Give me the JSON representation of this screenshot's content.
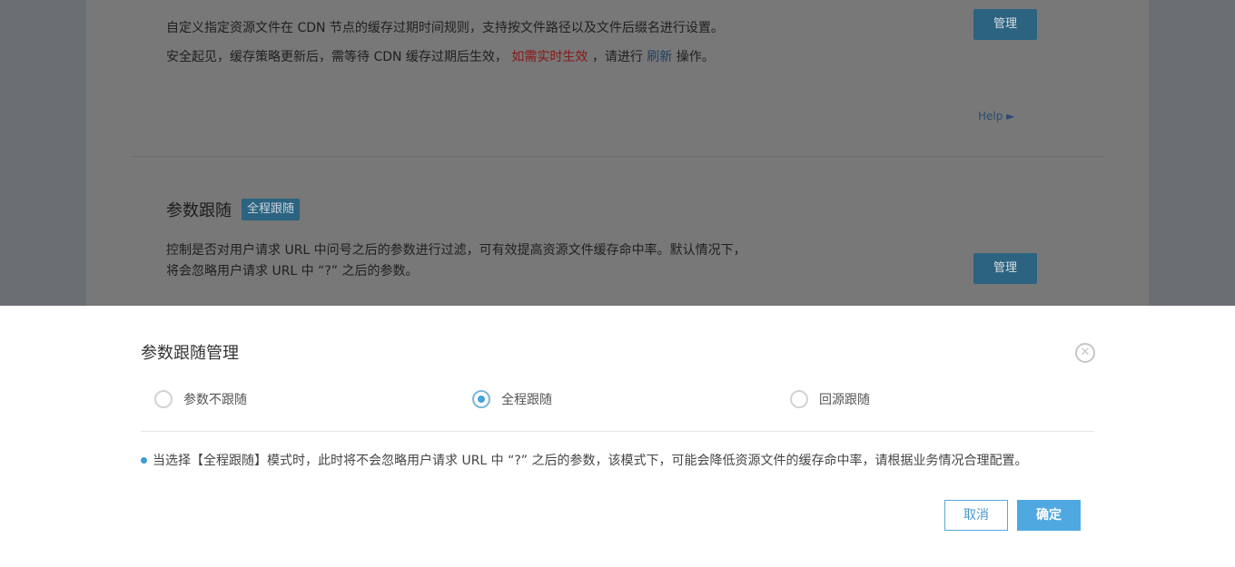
{
  "background": {
    "cache_desc_line1": "自定义指定资源文件在 CDN 节点的缓存过期时间规则，支持按文件路径以及文件后缀名进行设置。",
    "cache_desc_line2_pre": "安全起见，缓存策略更新后，需等待 CDN 缓存过期后生效，",
    "cache_desc_line2_red": "如需实时生效",
    "cache_desc_line2_mid": "，请进行",
    "cache_desc_line2_link": "刷新",
    "cache_desc_line2_post": "操作。",
    "manage_label_1": "管理",
    "help_label": "Help ►",
    "section_title": "参数跟随",
    "section_tag": "全程跟随",
    "section_desc_line1": "控制是否对用户请求 URL 中问号之后的参数进行过滤，可有效提高资源文件缓存命中率。默认情况下，",
    "section_desc_line2": "将会忽略用户请求 URL 中 “?” 之后的参数。",
    "manage_label_2": "管理"
  },
  "modal": {
    "title": "参数跟随管理",
    "close_icon": "close-circle-icon",
    "options": [
      {
        "label": "参数不跟随",
        "checked": false
      },
      {
        "label": "全程跟随",
        "checked": true
      },
      {
        "label": "回源跟随",
        "checked": false
      }
    ],
    "note": "当选择【全程跟随】模式时，此时将不会忽略用户请求 URL 中 “?” 之后的参数，该模式下，可能会降低资源文件的缓存命中率，请根据业务情况合理配置。",
    "cancel_label": "取消",
    "confirm_label": "确定"
  },
  "colors": {
    "accent": "#4fa8e0",
    "overlay": "#787878"
  }
}
